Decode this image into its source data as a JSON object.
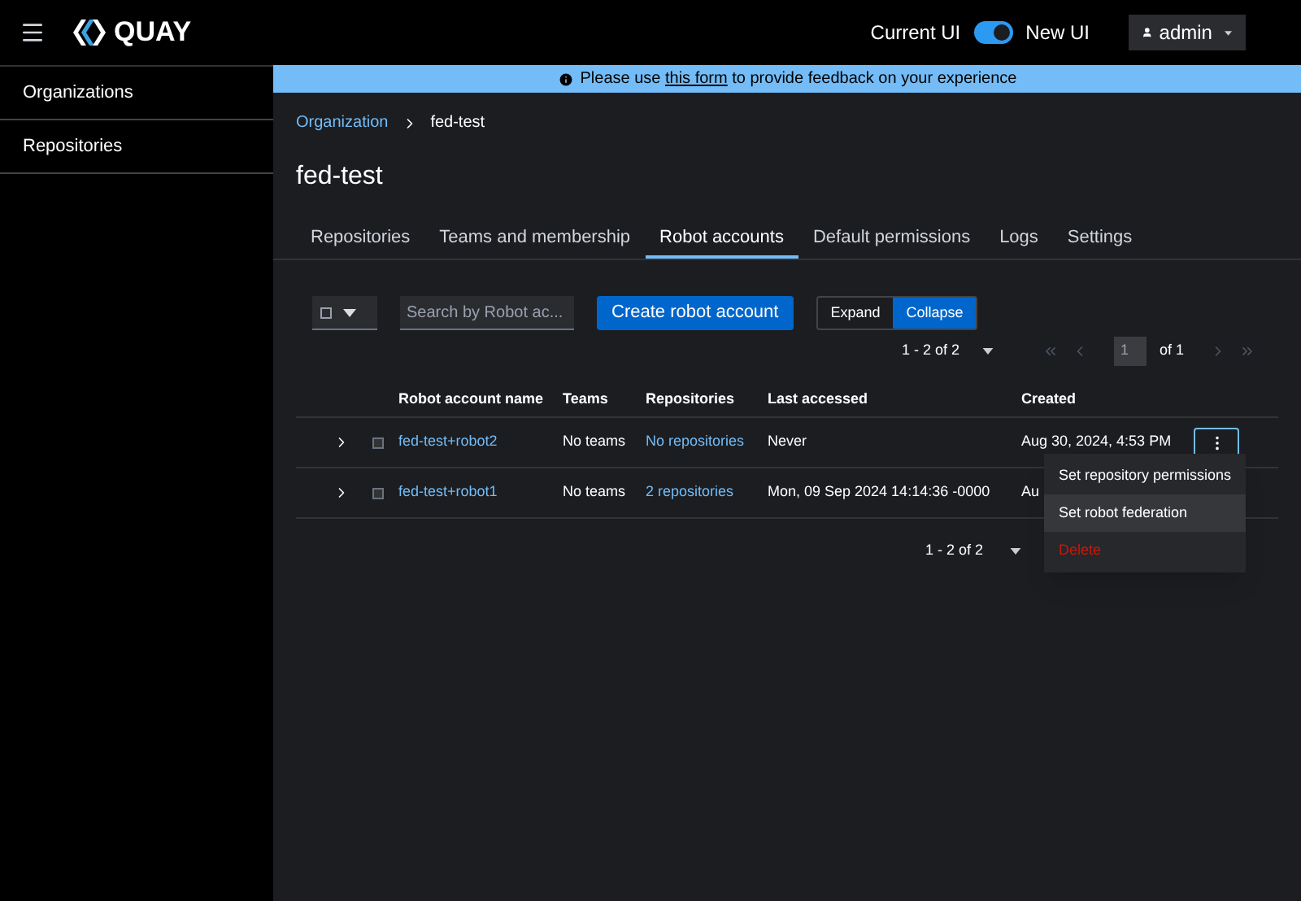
{
  "header": {
    "logo": "QUAY",
    "toggle_left": "Current UI",
    "toggle": {
      "on": true
    },
    "toggle_right": "New UI",
    "user": "admin"
  },
  "sidebar": {
    "items": [
      {
        "label": "Organizations",
        "selected": false
      },
      {
        "label": "Repositories",
        "selected": false
      }
    ]
  },
  "banner": {
    "before": "Please use",
    "link": "this form",
    "after": "to provide feedback on your experience"
  },
  "breadcrumb": {
    "parent": "Organization",
    "current": "fed-test"
  },
  "title": "fed-test",
  "tabs": [
    {
      "label": "Repositories",
      "selected": false
    },
    {
      "label": "Teams and membership",
      "selected": false
    },
    {
      "label": "Robot accounts",
      "selected": true
    },
    {
      "label": "Default permissions",
      "selected": false
    },
    {
      "label": "Logs",
      "selected": false
    },
    {
      "label": "Settings",
      "selected": false
    }
  ],
  "toolbar": {
    "search": {
      "placeholder": "Search by Robot ac..."
    },
    "create": "Create robot account",
    "toggle_group": [
      {
        "label": "Expand",
        "selected": false
      },
      {
        "label": "Collapse",
        "selected": true
      }
    ]
  },
  "pagination_top": {
    "range": "1 - 2 of 2",
    "page": "1",
    "of": "of 1"
  },
  "table": {
    "columns": [
      "Robot account name",
      "Teams",
      "Repositories",
      "Last accessed",
      "Created"
    ],
    "rows": [
      {
        "name": "fed-test+robot2",
        "teams": "No teams",
        "repositories": "No repositories",
        "last_accessed": "Never",
        "created": "Aug 30, 2024, 4:53 PM",
        "checked": false,
        "expanded": false
      },
      {
        "name": "fed-test+robot1",
        "teams": "No teams",
        "repositories": "2 repositories",
        "last_accessed": "Mon, 09 Sep 2024 14:14:36 -0000",
        "created": "Au",
        "checked": false,
        "expanded": false
      }
    ]
  },
  "pagination_bottom": {
    "range": "1 - 2 of 2"
  },
  "menu": {
    "items": [
      {
        "label": "Set repository permissions",
        "kind": "normal",
        "selected": false
      },
      {
        "label": "Set robot federation",
        "kind": "normal",
        "selected": true
      },
      {
        "label": "Delete",
        "kind": "danger",
        "selected": false
      }
    ]
  }
}
